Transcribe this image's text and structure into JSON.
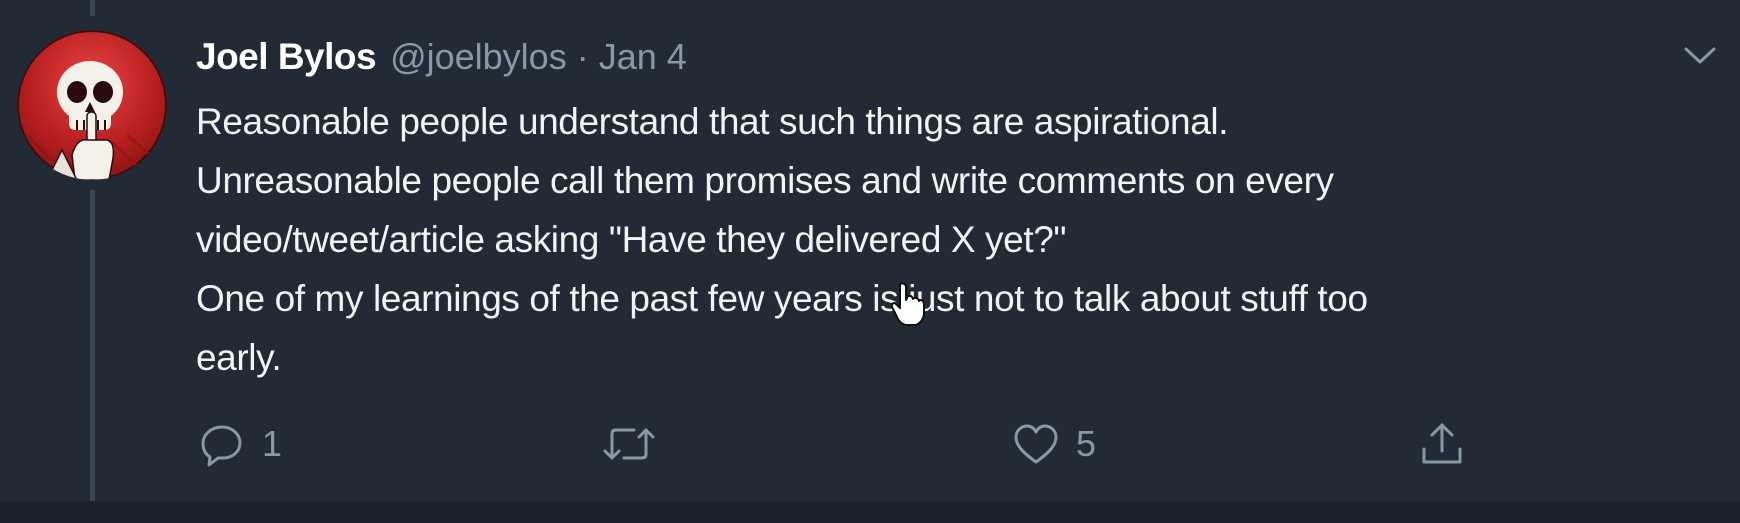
{
  "tweet": {
    "author_name": "Joel Bylos",
    "author_handle": "@joelbylos",
    "separator": "·",
    "date": "Jan 4",
    "lines": [
      "Reasonable people understand that such things are aspirational.",
      "Unreasonable people call them promises and write comments on every",
      "video/tweet/article asking \"Have they delivered X yet?\"",
      "One of my learnings of the past few years is just not to talk about stuff too",
      "early."
    ],
    "avatar_icon": "skull-avatar-icon",
    "colors": {
      "background": "#212a35",
      "text": "#f2f4f6",
      "muted": "#8899a6",
      "avatar": "#c62828"
    }
  },
  "actions": {
    "reply_count": "1",
    "retweet_count": "",
    "like_count": "5",
    "reply_icon": "reply-icon",
    "retweet_icon": "retweet-icon",
    "like_icon": "heart-icon",
    "share_icon": "share-icon",
    "menu_icon": "chevron-down-icon"
  }
}
